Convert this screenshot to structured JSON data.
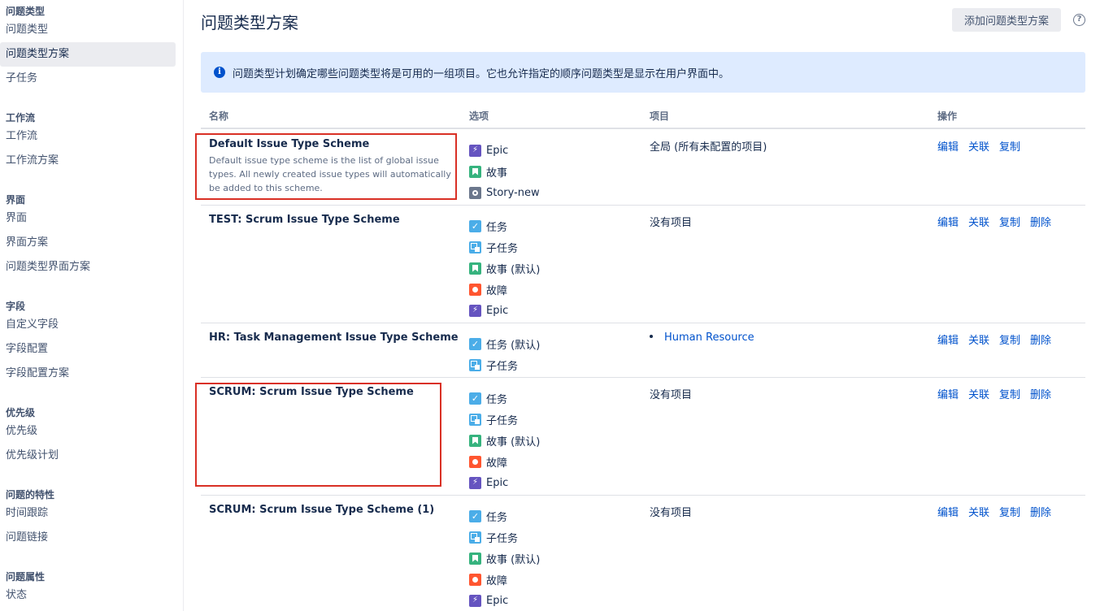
{
  "sidebar": {
    "groups": [
      {
        "title": "问题类型",
        "items": [
          "问题类型",
          "问题类型方案",
          "子任务"
        ]
      },
      {
        "title": "工作流",
        "items": [
          "工作流",
          "工作流方案"
        ]
      },
      {
        "title": "界面",
        "items": [
          "界面",
          "界面方案",
          "问题类型界面方案"
        ]
      },
      {
        "title": "字段",
        "items": [
          "自定义字段",
          "字段配置",
          "字段配置方案"
        ]
      },
      {
        "title": "优先级",
        "items": [
          "优先级",
          "优先级计划"
        ]
      },
      {
        "title": "问题的特性",
        "items": [
          "时间跟踪",
          "问题链接"
        ]
      },
      {
        "title": "问题属性",
        "items": [
          "状态"
        ]
      }
    ],
    "active": "问题类型方案"
  },
  "header": {
    "title": "问题类型方案",
    "add_button": "添加问题类型方案",
    "help_icon": "?"
  },
  "info": {
    "icon": "i",
    "text": "问题类型计划确定哪些问题类型将是可用的一组项目。它也允许指定的顺序问题类型是显示在用户界面中。"
  },
  "table": {
    "headers": {
      "name": "名称",
      "options": "选项",
      "projects": "项目",
      "ops": "操作"
    },
    "rows": [
      {
        "name": "Default Issue Type Scheme",
        "description": "Default issue type scheme is the list of global issue types. All newly created issue types will automatically be added to this scheme.",
        "options": [
          {
            "icon": "epic-icon",
            "label": "Epic"
          },
          {
            "icon": "story-icon",
            "label": "故事"
          },
          {
            "icon": "story-new-icon",
            "label": "Story-new"
          }
        ],
        "project": "全局 (所有未配置的项目)",
        "project_is_link": false,
        "ops": [
          "编辑",
          "关联",
          "复制"
        ]
      },
      {
        "name": "TEST: Scrum Issue Type Scheme",
        "description": "",
        "options": [
          {
            "icon": "task-icon",
            "label": "任务"
          },
          {
            "icon": "subtask-icon",
            "label": "子任务"
          },
          {
            "icon": "story-icon",
            "label": "故事 (默认)"
          },
          {
            "icon": "bug-icon",
            "label": "故障"
          },
          {
            "icon": "epic-icon",
            "label": "Epic"
          }
        ],
        "project": "没有项目",
        "project_is_link": false,
        "ops": [
          "编辑",
          "关联",
          "复制",
          "删除"
        ]
      },
      {
        "name": "HR: Task Management Issue Type Scheme",
        "description": "",
        "options": [
          {
            "icon": "task-icon",
            "label": "任务 (默认)"
          },
          {
            "icon": "subtask-icon",
            "label": "子任务"
          }
        ],
        "project": "Human Resource",
        "project_is_link": true,
        "ops": [
          "编辑",
          "关联",
          "复制",
          "删除"
        ]
      },
      {
        "name": "SCRUM: Scrum Issue Type Scheme",
        "description": "",
        "options": [
          {
            "icon": "task-icon",
            "label": "任务"
          },
          {
            "icon": "subtask-icon",
            "label": "子任务"
          },
          {
            "icon": "story-icon",
            "label": "故事 (默认)"
          },
          {
            "icon": "bug-icon",
            "label": "故障"
          },
          {
            "icon": "epic-icon",
            "label": "Epic"
          }
        ],
        "project": "没有项目",
        "project_is_link": false,
        "ops": [
          "编辑",
          "关联",
          "复制",
          "删除"
        ]
      },
      {
        "name": "SCRUM: Scrum Issue Type Scheme (1)",
        "description": "",
        "options": [
          {
            "icon": "task-icon",
            "label": "任务"
          },
          {
            "icon": "subtask-icon",
            "label": "子任务"
          },
          {
            "icon": "story-icon",
            "label": "故事 (默认)"
          },
          {
            "icon": "bug-icon",
            "label": "故障"
          },
          {
            "icon": "epic-icon",
            "label": "Epic"
          }
        ],
        "project": "没有项目",
        "project_is_link": false,
        "ops": [
          "编辑",
          "关联",
          "复制",
          "删除"
        ]
      }
    ]
  },
  "colors": {
    "link": "#0052cc",
    "info_bg": "#deebff",
    "highlight_box": "#d93025"
  }
}
